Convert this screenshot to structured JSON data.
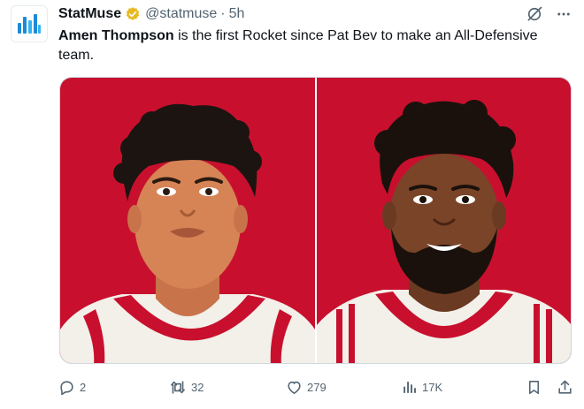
{
  "author": {
    "name": "StatMuse",
    "handle": "@statmuse",
    "separator": "·",
    "time": "5h",
    "verified_color": "#e8b923"
  },
  "tweet": {
    "mention": "Amen Thompson",
    "text": " is the first Rocket since Pat Bev to make an All-Defensive team."
  },
  "media": {
    "background_color": "#c8102e",
    "images": [
      {
        "subject": "player-illustration-left"
      },
      {
        "subject": "player-illustration-right"
      }
    ]
  },
  "actions": {
    "replies": "2",
    "retweets": "32",
    "likes": "279",
    "views": "17K"
  },
  "icons": [
    "statmuse-logo-icon",
    "verified-badge-icon",
    "grok-icon",
    "more-icon",
    "reply-icon",
    "retweet-icon",
    "like-icon",
    "views-icon",
    "bookmark-icon",
    "share-icon"
  ]
}
